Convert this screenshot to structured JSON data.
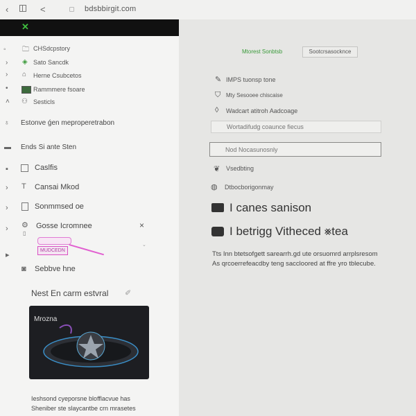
{
  "browser": {
    "back": "‹",
    "forward": "<",
    "url": "bdsbbirgit.com"
  },
  "sidebar": {
    "items": [
      {
        "icon": "folder",
        "label": "CHSdcpstory"
      },
      {
        "icon": "bag",
        "label": "Sato Sancdk"
      },
      {
        "icon": "home",
        "label": "Herne Csubcetos"
      },
      {
        "icon": "image",
        "label": "Rammmere fsoare"
      },
      {
        "icon": "person",
        "label": "Sesticls"
      }
    ]
  },
  "section_one": "Estonve ǵen meproperetrabon",
  "section_two": "Ends Si ante Sten",
  "rows": [
    {
      "icon": "square",
      "label": "Caslfis"
    },
    {
      "icon": "tee",
      "label": "Cansai Mkod"
    },
    {
      "icon": "doc",
      "label": "Sonmmsed oe"
    },
    {
      "icon": "gear",
      "label": "Gosse Icromnee"
    }
  ],
  "highlighted_chip": "MUDCEDN",
  "section_three": "Sebbve hne",
  "promo": {
    "title": "Nest En carm estvral",
    "card_label": "Mrozna"
  },
  "footer_text": [
    "Ieshsond cyeporsne blofflacvue has",
    "Sheniber ste slaycantbe crn mrasetes"
  ],
  "right": {
    "tabs": [
      {
        "label": "Mtorest Sonbtsb"
      },
      {
        "label": "Sootcrsasocknce"
      }
    ],
    "items": [
      {
        "icon": "pen",
        "label": "IMPS tuonsp tone"
      },
      {
        "icon": "shield",
        "label": "Mty Sesooee chiscaise"
      },
      {
        "icon": "tag",
        "label": "Wadcart atitroh Aadcoage"
      }
    ],
    "input1_placeholder": "Wortadifudg coaunce fiecus",
    "input2_placeholder": "Nod Nocasunosnly",
    "lower_items": [
      {
        "icon": "heart",
        "label": "Vsedbting"
      },
      {
        "icon": "badge",
        "label": "Dtbocborigonmay"
      }
    ],
    "large_items": [
      {
        "icon": "camera",
        "label": "I canes sanison"
      },
      {
        "icon": "gamepad",
        "label": "I betrigg Vitheced ⨳tea"
      }
    ],
    "paragraph": [
      "Tts Inn btetsofgett sarearrh.gd ute orsuomrd arrplsresom",
      "As qrcoerrefeacdby teng saccloored at ffre yro tblecube."
    ]
  },
  "colors": {
    "accent_green": "#3a9a3a",
    "highlight_pink": "#d94fc3",
    "dark": "#111111"
  }
}
